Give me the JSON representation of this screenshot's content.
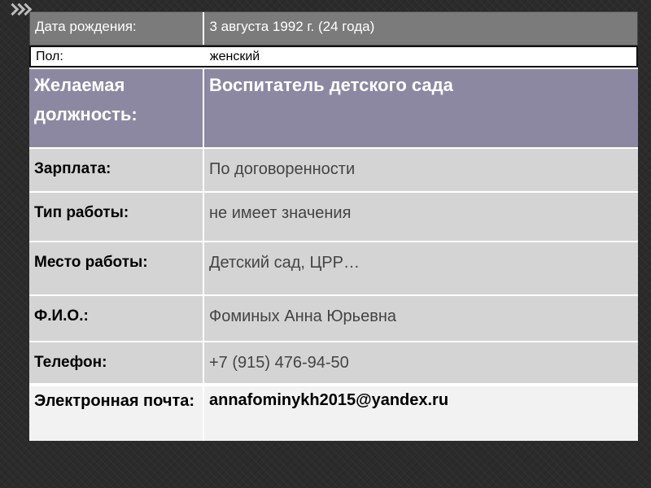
{
  "rows": [
    {
      "label": "Дата рождения:",
      "value": "3 августа 1992 г. (24 года)"
    },
    {
      "label": "Пол:",
      "value": "женский"
    },
    {
      "label": "Желаемая должность:",
      "value": "Воспитатель детского сада"
    },
    {
      "label": "Зарплата:",
      "value": "По договоренности"
    },
    {
      "label": "Тип работы:",
      "value": "не имеет значения"
    },
    {
      "label": "Место работы:",
      "value": "Детский сад, ЦРР…"
    },
    {
      "label": "Ф.И.О.:",
      "value": "Фоминых Анна Юрьевна"
    },
    {
      "label": "Телефон:",
      "value": "+7 (915) 476-94-50"
    },
    {
      "label": "Электронная почта:",
      "value": "annafominykh2015@yandex.ru"
    }
  ],
  "colors": {
    "background": "#2b2b2b",
    "header_row": "#7b7b7b",
    "position_row": "#8c88a2",
    "row_fill": "#d4d4d4",
    "email_row": "#f2f2f2"
  },
  "icons": [
    "chevron-right-icon",
    "chevron-right-icon",
    "chevron-right-icon"
  ]
}
